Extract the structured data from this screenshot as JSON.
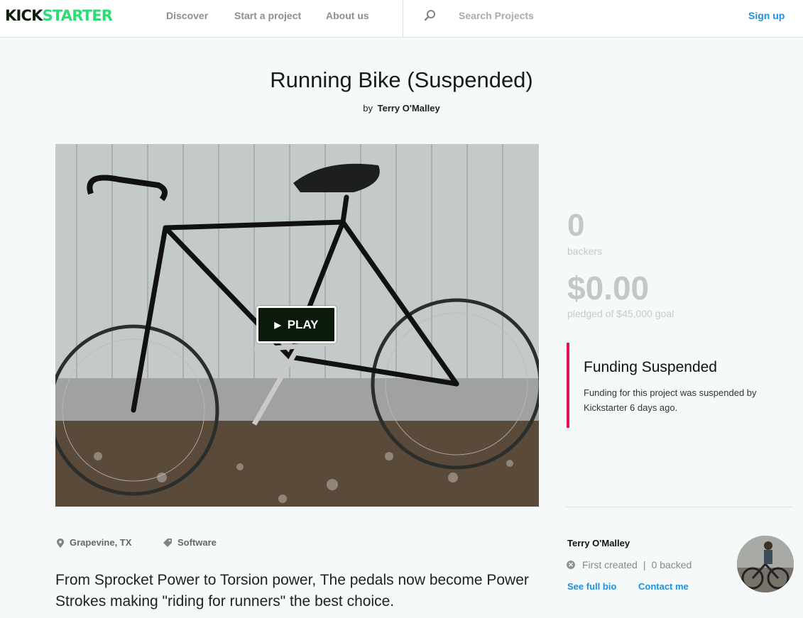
{
  "header": {
    "logo_part1": "KICK",
    "logo_part2": "STARTER",
    "nav": [
      "Discover",
      "Start a project",
      "About us"
    ],
    "search_placeholder": "Search Projects",
    "signup": "Sign up"
  },
  "project": {
    "title": "Running Bike (Suspended)",
    "by": "by",
    "creator": "Terry O'Malley",
    "play_label": "PLAY",
    "location": "Grapevine, TX",
    "category": "Software",
    "blurb": "From Sprocket Power to Torsion power, The pedals now become Power Strokes making \"riding for runners\" the best choice."
  },
  "stats": {
    "backers": "0",
    "backers_label": "backers",
    "pledged": "$0.00",
    "pledged_label": "pledged of $45,000 goal"
  },
  "notice": {
    "title": "Funding Suspended",
    "body": "Funding for this project was suspended by Kickstarter 6 days ago."
  },
  "creator_box": {
    "name": "Terry O'Malley",
    "created": "First created",
    "separator": "|",
    "backed": "0 backed",
    "bio_link": "See full bio",
    "contact_link": "Contact me"
  },
  "colors": {
    "brand_green": "#2bde73",
    "link_blue": "#2091db",
    "suspended_red": "#e1154f"
  }
}
